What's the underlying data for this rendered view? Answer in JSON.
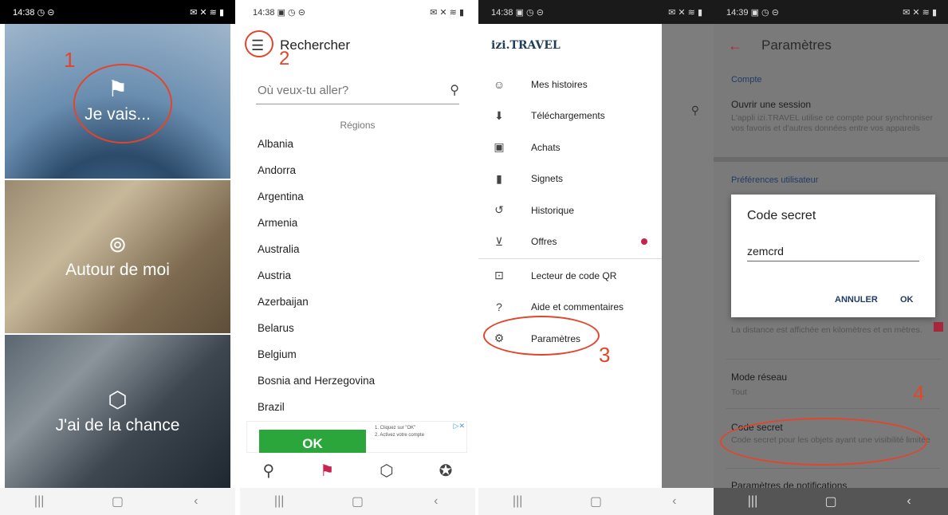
{
  "panel1": {
    "status_time": "14:38",
    "status_icons_left": "◷ ⊝",
    "status_icons_right": "✉ ✕ ≋ ▮",
    "tiles": [
      {
        "label": "Je vais...",
        "icon": "signpost-icon"
      },
      {
        "label": "Autour de moi",
        "icon": "map-pin-icon"
      },
      {
        "label": "J'ai de la chance",
        "icon": "dice-icon"
      }
    ],
    "step_label": "1"
  },
  "panel2": {
    "status_time": "14:38",
    "status_icons_left": "▣ ◷ ⊝",
    "status_icons_right": "✉ ✕ ≋ ▮",
    "title": "Rechercher",
    "step_label": "2",
    "search_placeholder": "Où veux-tu aller?",
    "section_header": "Régions",
    "countries": [
      "Albania",
      "Andorra",
      "Argentina",
      "Armenia",
      "Australia",
      "Austria",
      "Azerbaijan",
      "Belarus",
      "Belgium",
      "Bosnia and Herzegovina",
      "Brazil"
    ],
    "ad": {
      "button_label": "OK",
      "line1": "1. Cliquez sur \"OK\"",
      "line2": "2. Activez votre compte"
    }
  },
  "panel3": {
    "status_time": "14:38",
    "status_icons_left": "▣ ◷ ⊝",
    "status_icons_right": "✉ ✕ ≋ ▮",
    "logo_text": "izi.TRAVEL",
    "menu_items": [
      {
        "label": "Mes histoires",
        "icon": "face-icon"
      },
      {
        "label": "Téléchargements",
        "icon": "download-icon"
      },
      {
        "label": "Achats",
        "icon": "shop-icon"
      },
      {
        "label": "Signets",
        "icon": "bookmark-icon"
      },
      {
        "label": "Historique",
        "icon": "history-icon"
      },
      {
        "label": "Offres",
        "icon": "cart-icon",
        "badge": true
      },
      {
        "label": "Lecteur de code QR",
        "icon": "qr-scan-icon"
      },
      {
        "label": "Aide et commentaires",
        "icon": "help-icon"
      },
      {
        "label": "Paramètres",
        "icon": "gear-icon"
      }
    ],
    "step_label": "3"
  },
  "panel4": {
    "status_time": "14:39",
    "status_icons_left": "▣ ◷ ⊝",
    "status_icons_right": "✉ ✕ ≋ ▮",
    "title": "Paramètres",
    "section_account": "Compte",
    "open_session_title": "Ouvrir une session",
    "open_session_desc": "L'appli izi.TRAVEL utilise ce compte pour synchroniser vos favoris et d'autres données entre vos appareils",
    "section_prefs": "Préférences utilisateur",
    "dialog": {
      "title": "Code secret",
      "value": "zemcrd",
      "cancel": "ANNULER",
      "ok": "OK"
    },
    "distance_desc": "La distance est affichée en kilomètres et en mètres.",
    "network_title": "Mode réseau",
    "network_value": "Tout",
    "code_title": "Code secret",
    "code_desc": "Code secret pour les objets ayant une visibilité limitée",
    "notif_title": "Paramètres de notifications",
    "step_label": "4"
  },
  "colors": {
    "accent_red": "#e2452b",
    "brand_magenta": "#c8234e",
    "link_blue": "#1f3d66"
  }
}
